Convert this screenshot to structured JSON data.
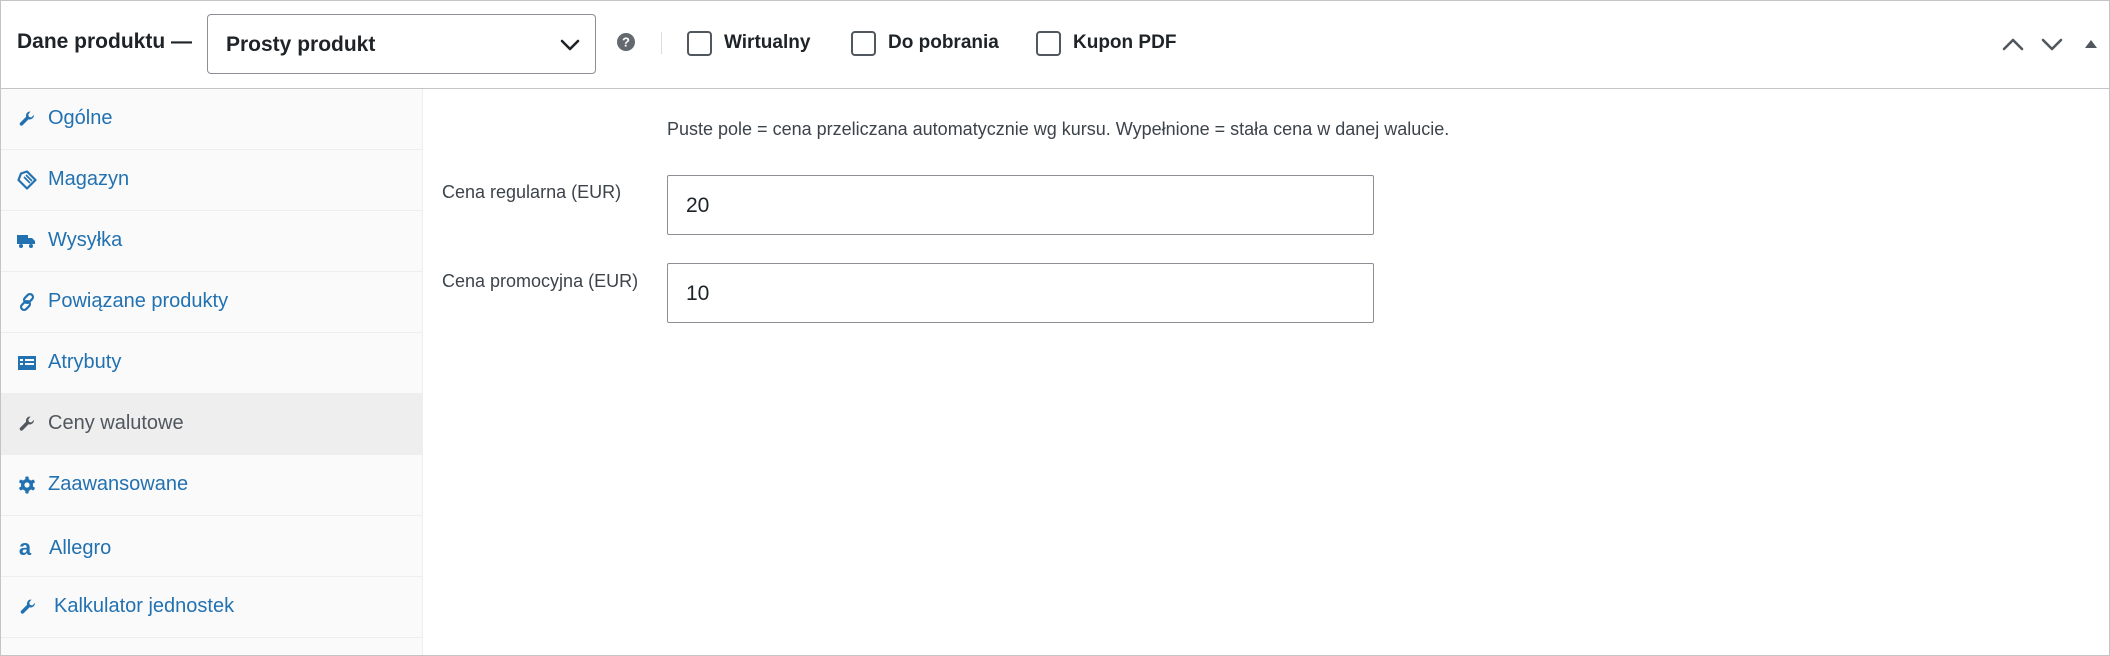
{
  "header": {
    "title": "Dane produktu —",
    "product_type": {
      "selected": "Prosty produkt"
    },
    "checkboxes": [
      {
        "label": "Wirtualny",
        "checked": false
      },
      {
        "label": "Do pobrania",
        "checked": false
      },
      {
        "label": "Kupon PDF",
        "checked": false
      }
    ],
    "icons": {
      "help": "question-circle-icon",
      "move_up": "chevron-up-icon",
      "move_down": "chevron-down-icon",
      "toggle": "triangle-up-icon"
    }
  },
  "sidebar": {
    "items": [
      {
        "label": "Ogólne",
        "icon": "wrench-icon",
        "active": false
      },
      {
        "label": "Magazyn",
        "icon": "tag-icon",
        "active": false
      },
      {
        "label": "Wysyłka",
        "icon": "truck-icon",
        "active": false
      },
      {
        "label": "Powiązane produkty",
        "icon": "link-icon",
        "active": false
      },
      {
        "label": "Atrybuty",
        "icon": "list-table-icon",
        "active": false
      },
      {
        "label": "Ceny walutowe",
        "icon": "wrench-icon",
        "active": true
      },
      {
        "label": "Zaawansowane",
        "icon": "gear-icon",
        "active": false
      },
      {
        "label": "Allegro",
        "icon": "allegro-a-icon",
        "active": false
      },
      {
        "label": "Kalkulator jednostek",
        "icon": "wrench-icon",
        "active": false
      }
    ]
  },
  "main": {
    "hint": "Puste pole = cena przeliczana automatycznie wg kursu. Wypełnione = stała cena w danej walucie.",
    "fields": [
      {
        "label": "Cena regularna (EUR)",
        "value": "20"
      },
      {
        "label": "Cena promocyjna (EUR)",
        "value": "10"
      }
    ]
  },
  "colors": {
    "link": "#2271b1",
    "active_label": "#50575e",
    "active_bg": "#eeeeee",
    "sidebar_bg": "#fafafa",
    "border": "#c3c4c7"
  }
}
